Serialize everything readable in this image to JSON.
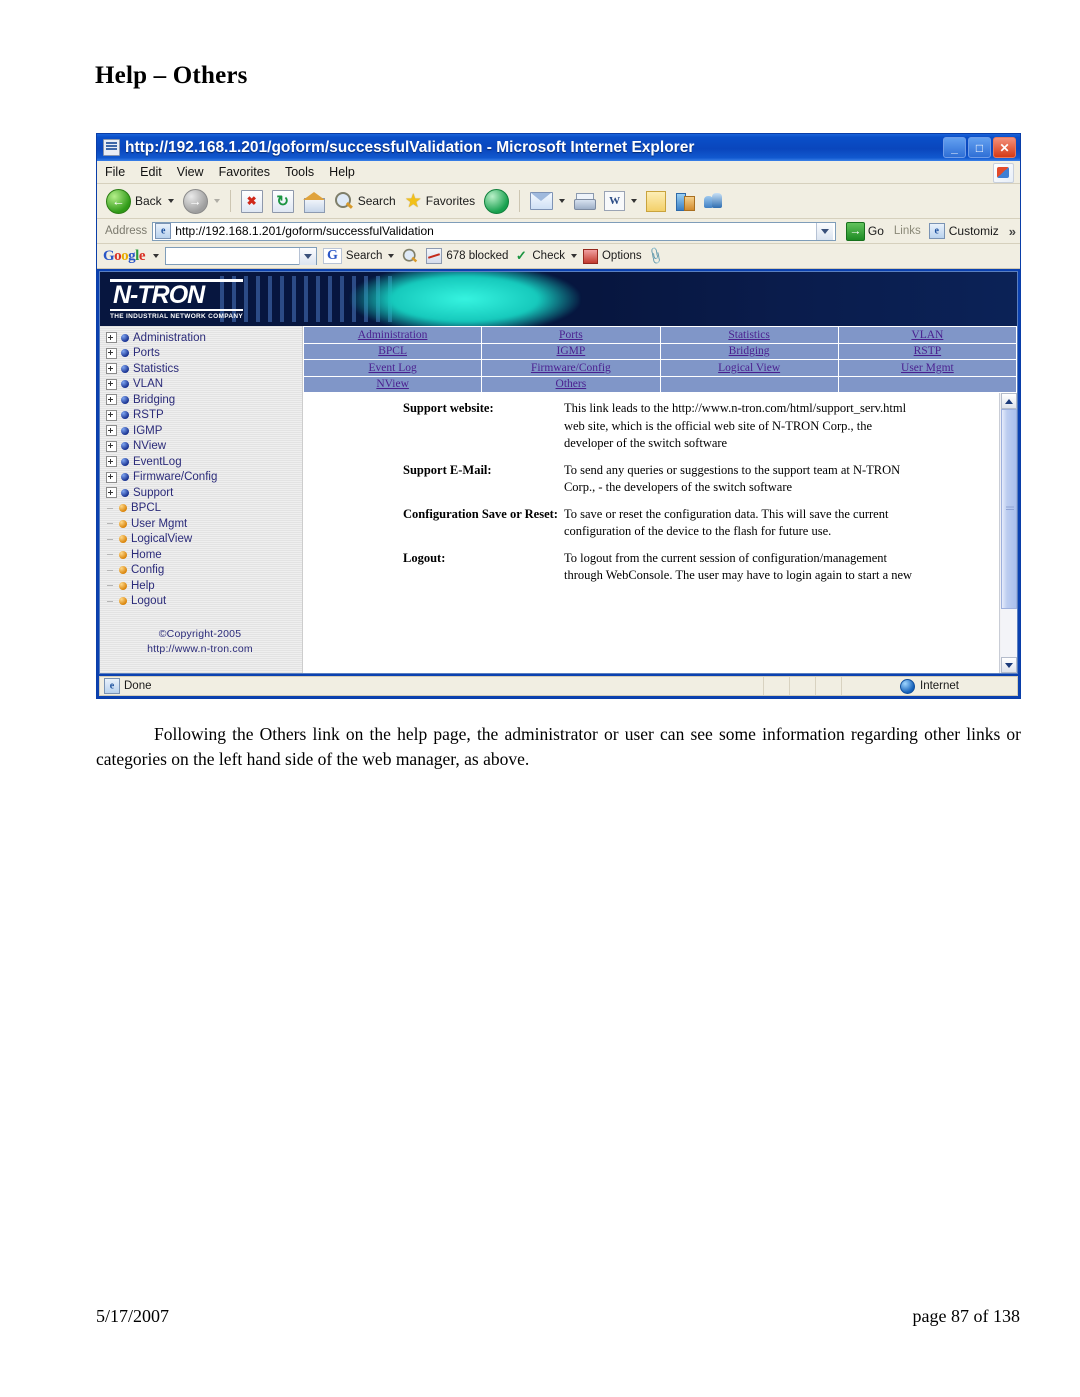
{
  "document": {
    "heading": "Help – Others",
    "paragraph": "Following the Others link on the help page, the administrator or user can see some information regarding other links or categories on the left hand side of the web manager, as above.",
    "footer_date": "5/17/2007",
    "footer_page": "page 87 of 138"
  },
  "browser": {
    "title": "http://192.168.1.201/goform/successfulValidation - Microsoft Internet Explorer",
    "window_buttons": {
      "minimize": "_",
      "maximize": "□",
      "close": "✕"
    },
    "menu": [
      "File",
      "Edit",
      "View",
      "Favorites",
      "Tools",
      "Help"
    ],
    "toolbar": {
      "back": "Back",
      "forward": "",
      "stop": "",
      "refresh": "",
      "home": "",
      "search": "Search",
      "favorites": "Favorites",
      "media": "",
      "mail": "",
      "print": "",
      "edit_word": "",
      "notes": "",
      "messenger": "",
      "contacts": ""
    },
    "address": {
      "label": "Address",
      "value": "http://192.168.1.201/goform/successfulValidation",
      "go_label": "Go",
      "links_label": "Links",
      "customize_label": "Customiz",
      "overflow": "»"
    },
    "google_bar": {
      "logo": "Google",
      "search_value": "",
      "search_label": "Search",
      "blocked_label": "678 blocked",
      "check_label": "Check",
      "options_label": "Options"
    },
    "status": {
      "text": "Done",
      "zone": "Internet"
    }
  },
  "webpage": {
    "banner": {
      "logo_main": "N-TRON",
      "logo_sub": "THE INDUSTRIAL NETWORK COMPANY"
    },
    "tree": {
      "items": [
        {
          "label": "Administration",
          "expandable": true,
          "dot": "blue"
        },
        {
          "label": "Ports",
          "expandable": true,
          "dot": "blue"
        },
        {
          "label": "Statistics",
          "expandable": true,
          "dot": "blue"
        },
        {
          "label": "VLAN",
          "expandable": true,
          "dot": "blue"
        },
        {
          "label": "Bridging",
          "expandable": true,
          "dot": "blue"
        },
        {
          "label": "RSTP",
          "expandable": true,
          "dot": "blue"
        },
        {
          "label": "IGMP",
          "expandable": true,
          "dot": "blue"
        },
        {
          "label": "NView",
          "expandable": true,
          "dot": "blue"
        },
        {
          "label": "EventLog",
          "expandable": true,
          "dot": "blue"
        },
        {
          "label": "Firmware/Config",
          "expandable": true,
          "dot": "blue"
        },
        {
          "label": "Support",
          "expandable": true,
          "dot": "blue"
        },
        {
          "label": "BPCL",
          "expandable": false,
          "dot": "orange"
        },
        {
          "label": "User Mgmt",
          "expandable": false,
          "dot": "orange"
        },
        {
          "label": "LogicalView",
          "expandable": false,
          "dot": "orange"
        },
        {
          "label": "Home",
          "expandable": false,
          "dot": "orange"
        },
        {
          "label": "Config",
          "expandable": false,
          "dot": "orange"
        },
        {
          "label": "Help",
          "expandable": false,
          "dot": "orange"
        },
        {
          "label": "Logout",
          "expandable": false,
          "dot": "orange"
        }
      ],
      "copyright": "©Copyright-2005",
      "website": "http://www.n-tron.com"
    },
    "link_grid": {
      "rows": [
        [
          "Administration",
          "Ports",
          "Statistics",
          "VLAN"
        ],
        [
          "BPCL",
          "IGMP",
          "Bridging",
          "RSTP"
        ],
        [
          "Event Log",
          "Firmware/Config",
          "Logical View",
          "User Mgmt"
        ],
        [
          "NView",
          "Others",
          "",
          ""
        ]
      ]
    },
    "help_entries": [
      {
        "term": "Support website:",
        "desc": "This link leads to the http://www.n-tron.com/html/support_serv.html web site, which is the official web site of N-TRON Corp., the developer of the switch software"
      },
      {
        "term": "Support E-Mail:",
        "desc": "To send any queries or suggestions to the support team at N-TRON Corp., - the developers of the switch software"
      },
      {
        "term": "Configuration Save or Reset:",
        "desc": "To save or reset the configuration data. This will save the current configuration of the device to the flash for future use."
      },
      {
        "term": "Logout:",
        "desc": "To logout from the current session of configuration/management through WebConsole. The user may have to login again to start a new"
      }
    ]
  },
  "colors": {
    "titlebar_blue": "#0a46bd",
    "chrome_tan": "#f1eee2",
    "link_purple": "#4a1f8f",
    "grid_blue": "#8096c8",
    "banner_navy": "#07163f",
    "banner_cyan": "#16c9bc",
    "tree_text": "#2b2b7a"
  }
}
